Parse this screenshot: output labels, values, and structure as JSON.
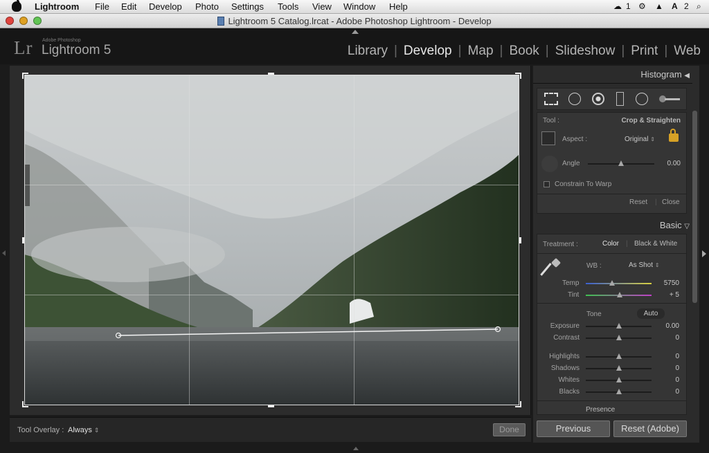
{
  "menubar": {
    "app": "Lightroom",
    "items": [
      "File",
      "Edit",
      "Develop",
      "Photo",
      "Settings",
      "Tools",
      "View",
      "Window",
      "Help"
    ],
    "tray": {
      "count1": "1",
      "count2": "2"
    }
  },
  "window": {
    "title": "Lightroom 5 Catalog.lrcat - Adobe Photoshop Lightroom - Develop"
  },
  "identity": {
    "small": "Adobe Photoshop",
    "name": "Lightroom 5",
    "logo": "Lr"
  },
  "modules": [
    "Library",
    "Develop",
    "Map",
    "Book",
    "Slideshow",
    "Print",
    "Web"
  ],
  "active_module": "Develop",
  "toolbar": {
    "overlay_label": "Tool Overlay :",
    "overlay_value": "Always",
    "done_label": "Done"
  },
  "histogram": {
    "title": "Histogram"
  },
  "crop": {
    "tool_label": "Tool :",
    "tool_value": "Crop & Straighten",
    "aspect_label": "Aspect :",
    "aspect_value": "Original",
    "angle_label": "Angle",
    "angle_value": "0.00",
    "angle_fraction": 0.5,
    "constrain_label": "Constrain To Warp",
    "reset_label": "Reset",
    "close_label": "Close"
  },
  "basic": {
    "title": "Basic",
    "treatment_label": "Treatment :",
    "color_label": "Color",
    "bw_label": "Black & White",
    "wb_label": "WB :",
    "wb_value": "As Shot",
    "temp_label": "Temp",
    "temp_value": "5750",
    "tint_label": "Tint",
    "tint_value": "+ 5",
    "tone_label": "Tone",
    "auto_label": "Auto",
    "sliders": [
      {
        "label": "Exposure",
        "value": "0.00"
      },
      {
        "label": "Contrast",
        "value": "0"
      },
      {
        "label": "Highlights",
        "value": "0"
      },
      {
        "label": "Shadows",
        "value": "0"
      },
      {
        "label": "Whites",
        "value": "0"
      },
      {
        "label": "Blacks",
        "value": "0"
      }
    ],
    "presence_label": "Presence"
  },
  "buttons": {
    "previous": "Previous",
    "reset": "Reset (Adobe)"
  },
  "colors": {
    "panel_bg": "#2b2b2b",
    "subpanel_bg": "#353535",
    "text": "#c9c9c9"
  }
}
